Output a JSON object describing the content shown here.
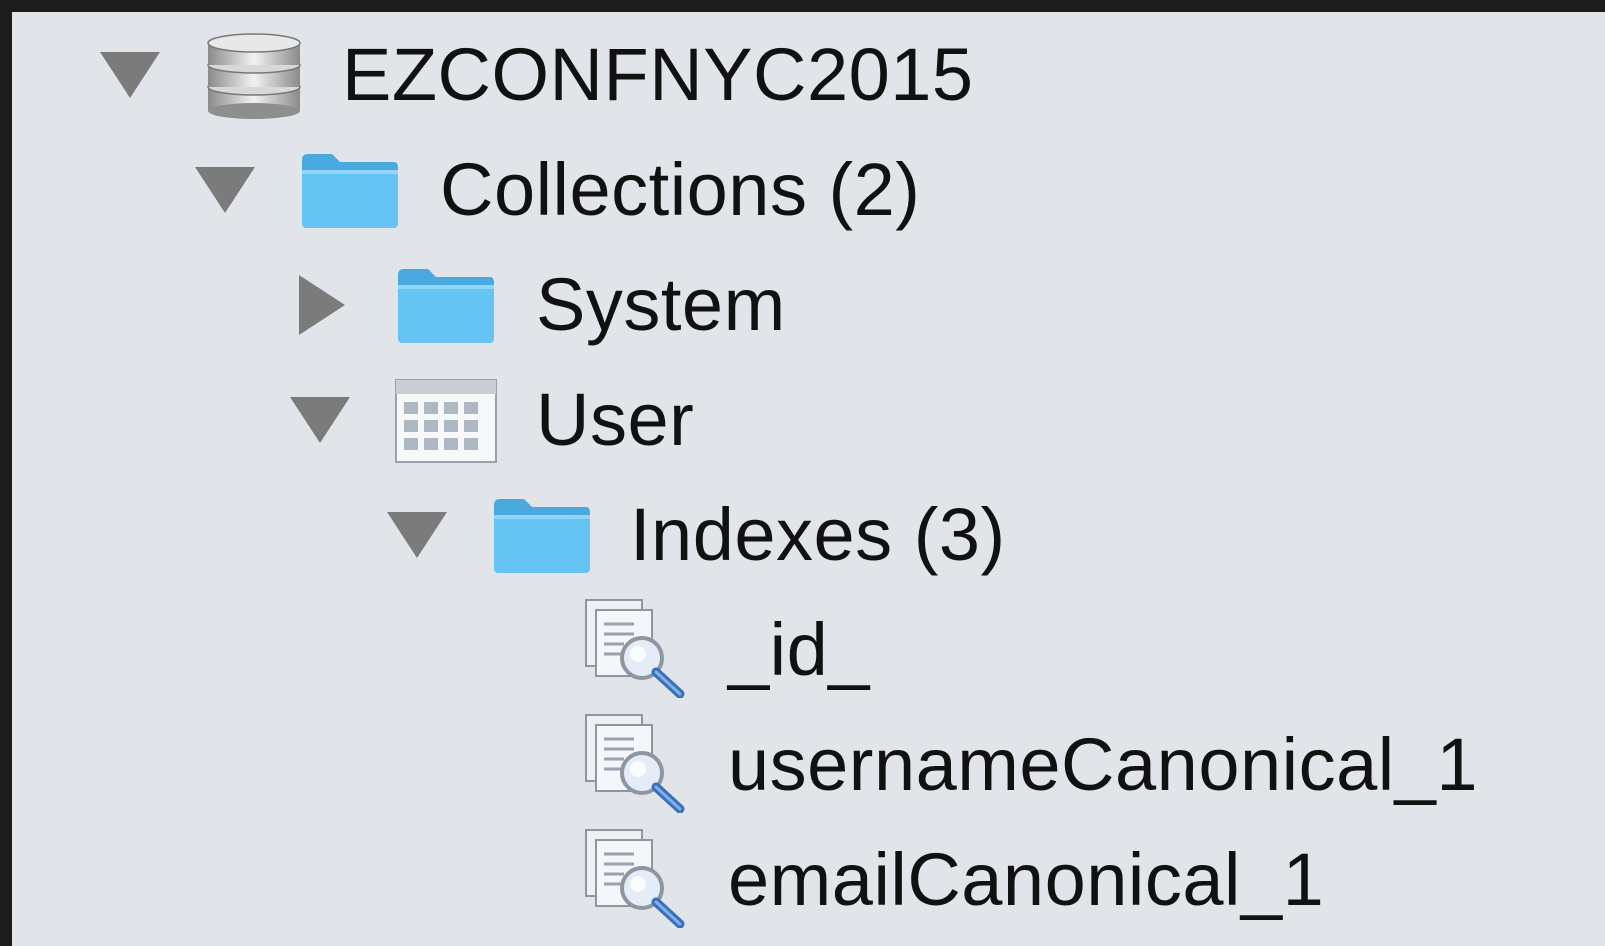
{
  "tree": {
    "database": {
      "label": "EZCONFNYC2015",
      "icon": "database-icon",
      "expanded": true
    },
    "collections": {
      "label": "Collections (2)",
      "icon": "folder-icon",
      "expanded": true
    },
    "system": {
      "label": "System",
      "icon": "folder-icon",
      "expanded": false
    },
    "user": {
      "label": "User",
      "icon": "table-icon",
      "expanded": true
    },
    "indexes": {
      "label": "Indexes (3)",
      "icon": "folder-icon",
      "expanded": true
    },
    "index_items": [
      {
        "label": "_id_",
        "icon": "index-icon"
      },
      {
        "label": "usernameCanonical_1",
        "icon": "index-icon"
      },
      {
        "label": "emailCanonical_1",
        "icon": "index-icon"
      }
    ]
  },
  "colors": {
    "panel_background": "#e1e5ea",
    "frame": "#1c1c1c",
    "folder_blue": "#5fc0f2",
    "disclosure_triangle": "#7b7b7b"
  }
}
